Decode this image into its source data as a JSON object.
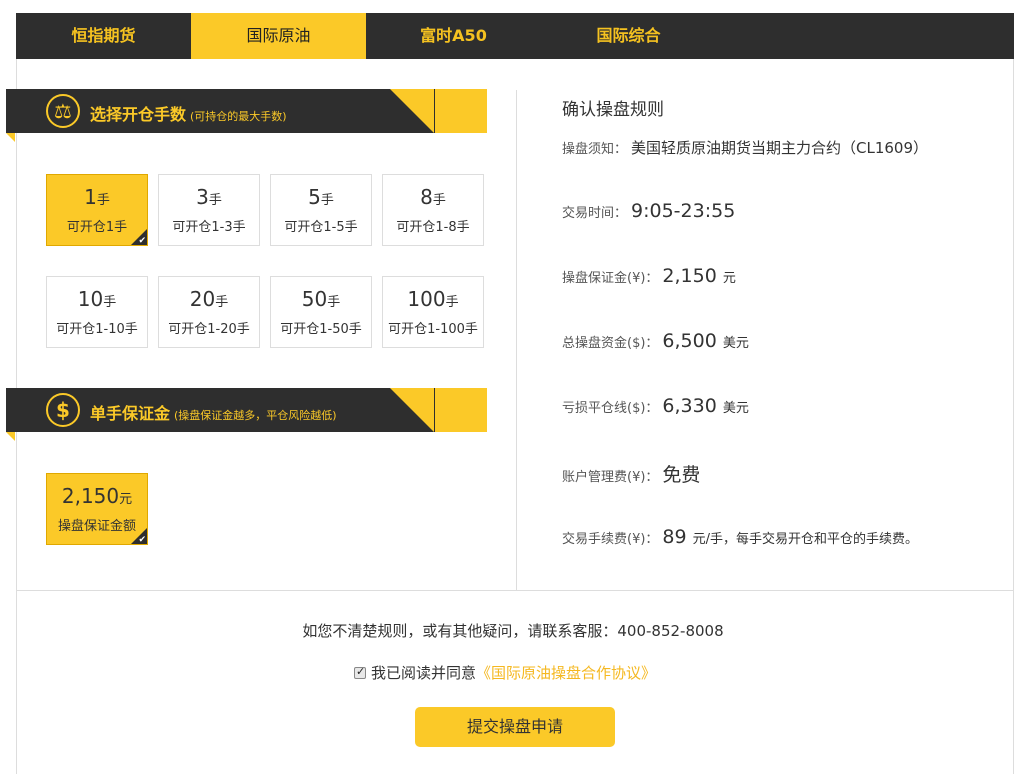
{
  "tabs": [
    {
      "label": "恒指期货",
      "active": false
    },
    {
      "label": "国际原油",
      "active": true
    },
    {
      "label": "富时A50",
      "active": false
    },
    {
      "label": "国际综合",
      "active": false
    }
  ],
  "lots_section": {
    "title": "选择开仓手数",
    "subtitle": "(可持仓的最大手数)",
    "icon": "scale-icon"
  },
  "lots": [
    {
      "num": "1",
      "unit": "手",
      "desc": "可开仓1手",
      "selected": true
    },
    {
      "num": "3",
      "unit": "手",
      "desc": "可开仓1-3手",
      "selected": false
    },
    {
      "num": "5",
      "unit": "手",
      "desc": "可开仓1-5手",
      "selected": false
    },
    {
      "num": "8",
      "unit": "手",
      "desc": "可开仓1-8手",
      "selected": false
    },
    {
      "num": "10",
      "unit": "手",
      "desc": "可开仓1-10手",
      "selected": false
    },
    {
      "num": "20",
      "unit": "手",
      "desc": "可开仓1-20手",
      "selected": false
    },
    {
      "num": "50",
      "unit": "手",
      "desc": "可开仓1-50手",
      "selected": false
    },
    {
      "num": "100",
      "unit": "手",
      "desc": "可开仓1-100手",
      "selected": false
    }
  ],
  "margin_section": {
    "title": "单手保证金",
    "subtitle": "(操盘保证金越多，平仓风险越低)",
    "icon": "dollar-icon"
  },
  "margin_option": {
    "num": "2,150",
    "unit": "元",
    "desc": "操盘保证金额",
    "selected": true
  },
  "rules": {
    "title": "确认操盘规则",
    "notice_label": "操盘须知：",
    "notice_value": "美国轻质原油期货当期主力合约（CL1609）",
    "time_label": "交易时间：",
    "time_value": "9:05-23:55",
    "margin_label": "操盘保证金(¥)：",
    "margin_value": "2,150",
    "margin_unit": "元",
    "total_label": "总操盘资金($)：",
    "total_value": "6,500",
    "total_unit": "美元",
    "stop_label": "亏损平仓线($)：",
    "stop_value": "6,330",
    "stop_unit": "美元",
    "fee_label": "账户管理费(¥)：",
    "fee_value": "免费",
    "commission_label": "交易手续费(¥)：",
    "commission_value": "89",
    "commission_unit": "元/手，每手交易开仓和平仓的手续费。"
  },
  "help_text": "如您不清楚规则，或有其他疑问，请联系客服：400-852-8008",
  "agree": {
    "text": "我已阅读并同意",
    "link": "《国际原油操盘合作协议》",
    "checked": true
  },
  "submit_label": "提交操盘申请",
  "colors": {
    "accent": "#fbc928",
    "dark": "#2e2e2e"
  }
}
